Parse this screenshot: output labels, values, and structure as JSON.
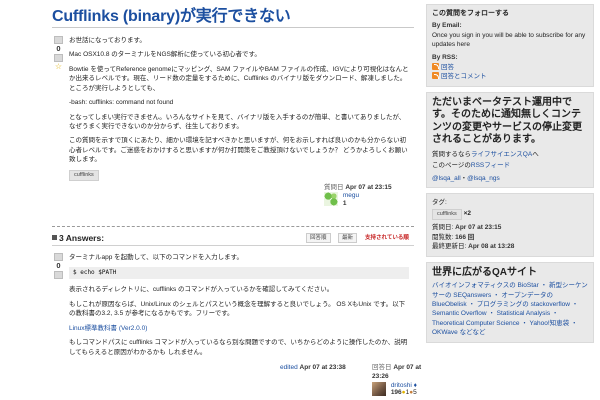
{
  "question": {
    "title": "Cufflinks (binary)が実行できない",
    "votes": "0",
    "paragraphs": [
      "お世話になっております。",
      "Mac OSX10.8 のターミナルをNGS解析に使っている初心者です。",
      "Bowtie を使ってReference genomeにマッピング、SAM ファイルやBAM ファイルの作成、IGVにより可視化はなんとか出来るレベルです。現在、リード数の定量をするために、Cufflinks のバイナリ版をダウンロード、解凍しました。ところが実行しようとしても、",
      "-bash: cufflinks: command not found",
      "となってしまい実行できません。いろんなサイトを見て、バイナリ版を入手するのが簡単、と書いてありましたが、なぜうまく実行できないのか分からず、往生しております。",
      "この質問を示すで頂くにあたり、細かい環境を記すべきかと思いますが、何をお示しすれば良いのかも分からない初心者レベルです。ご迷惑をおかけすると思いますが何か打開策をご教授頂けないでしょうか？ どうかよろしくお願い致します。"
    ],
    "tag": "cufflinks",
    "asked_label": "質問日",
    "asked_date": "Apr 07 at 23:15",
    "asker_name": "megu",
    "asker_rep": "1"
  },
  "answers_header": {
    "count_label": "3 Answers:",
    "sort_oldest": "回答順",
    "sort_newest": "最新",
    "sort_votes": "支持されている順"
  },
  "answer": {
    "votes": "0",
    "p1": "ターミナルapp を起動して、以下のコマンドを入力します。",
    "code": "$ echo $PATH",
    "p2": "表示されるディレクトリに、cufflinks のコマンドが入っているかを確認してみてください。",
    "p3": "もしこれが原因ならば、Unix/Linux のシェルとパスという概念を理解すると良いでしょう。 OS XもUnix です。以下の教科書の3.2, 3.5 が参考になるかもです。フリーです。",
    "link": "Linux標準教科書 (Ver2.0.0)",
    "p4": "もしコマンドパスに cufflinks コマンドが入っているなら別な問題ですので、いちからどのように操作したのか、説明してもらえると原因がわかるかも しれません。",
    "edited_label": "edited",
    "edited_date": "Apr 07 at 23:38",
    "answered_label": "回答日",
    "answered_date": "Apr 07 at 23:26",
    "answerer_name": "dritoshi ♦",
    "answerer_rep": "196",
    "badge_gold": "1",
    "badge_bronze": "5"
  },
  "sidebar": {
    "follow": {
      "title": "この質問をフォローする",
      "by_email": "By Email:",
      "email_text": "Once you sign in you will be able to subscribe for any updates here",
      "by_rss": "By RSS:",
      "rss_answers": "回答",
      "rss_answers_comments": "回答とコメント"
    },
    "beta": {
      "title": "ただいまベータテスト運用中です。そのために通知無しくコンテンツの変更やサービスの停止変更されることがあります。",
      "text_prefix": "質問するなら",
      "text_link": "ライフサイエンスQA",
      "text_suffix": "へ",
      "rss_prefix": "このページの",
      "rss_link": "RSSフィード",
      "twitter1": "@lsqa_all",
      "sep": "・",
      "twitter2": "@lsqa_ngs"
    },
    "stats": {
      "tags_label": "タグ:",
      "tag": "cufflinks",
      "tag_count": "×2",
      "asked_label": "質問日:",
      "asked_value": "Apr 07 at 23:15",
      "seen_label": "閲覧数:",
      "seen_value": "166 回",
      "updated_label": "最終更新日:",
      "updated_value": "Apr 08 at 13:28"
    },
    "worldqa": {
      "title": "世界に広がるQAサイト",
      "text": "バイオインフォマティクスの BioStar ・ 新型シーケンサーの SEQanswers ・ オープンデータの BlueObelisk ・ プログラミングの stackoverflow ・ Semantic Overflow ・ Statistical Analysis ・ Theoretical Computer Science ・ Yahoo!知恵袋 ・ OKWave などなど"
    }
  }
}
